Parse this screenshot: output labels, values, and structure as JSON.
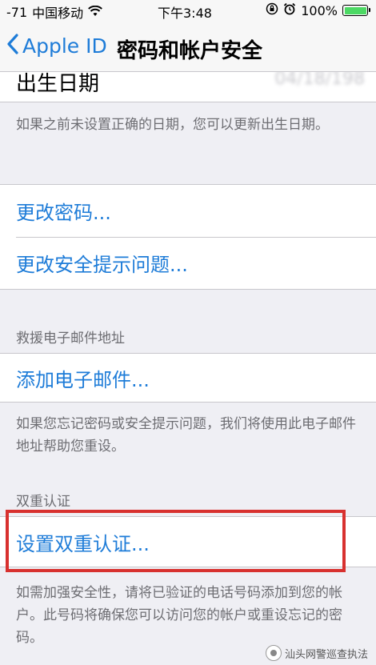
{
  "status_bar": {
    "signal": "-71",
    "carrier": "中国移动",
    "time": "下午3:48",
    "battery": "100%",
    "battery_level": 1.0
  },
  "nav": {
    "back_label": "Apple ID",
    "title": "密码和帐户安全"
  },
  "birthday": {
    "label": "出生日期",
    "value": "04/18/198"
  },
  "birthday_footer": "如果之前未设置正确的日期，您可以更新出生日期。",
  "password_group": {
    "change_password": "更改密码...",
    "change_security_questions": "更改安全提示问题..."
  },
  "rescue_email": {
    "header": "救援电子邮件地址",
    "add_email": "添加电子邮件...",
    "footer": "如果您忘记密码或安全提示问题，我们将使用此电子邮件地址帮助您重设。"
  },
  "two_factor": {
    "header": "双重认证",
    "setup": "设置双重认证...",
    "footer": "如需加强安全性，请将已验证的电话号码添加到您的帐户。此号码将确保您可以访问您的帐户或重设忘记的密码。"
  },
  "watermark": "汕头网警巡查执法",
  "colors": {
    "link": "#1e7cd8",
    "highlight": "#d8312f",
    "battery": "#4cd964"
  }
}
